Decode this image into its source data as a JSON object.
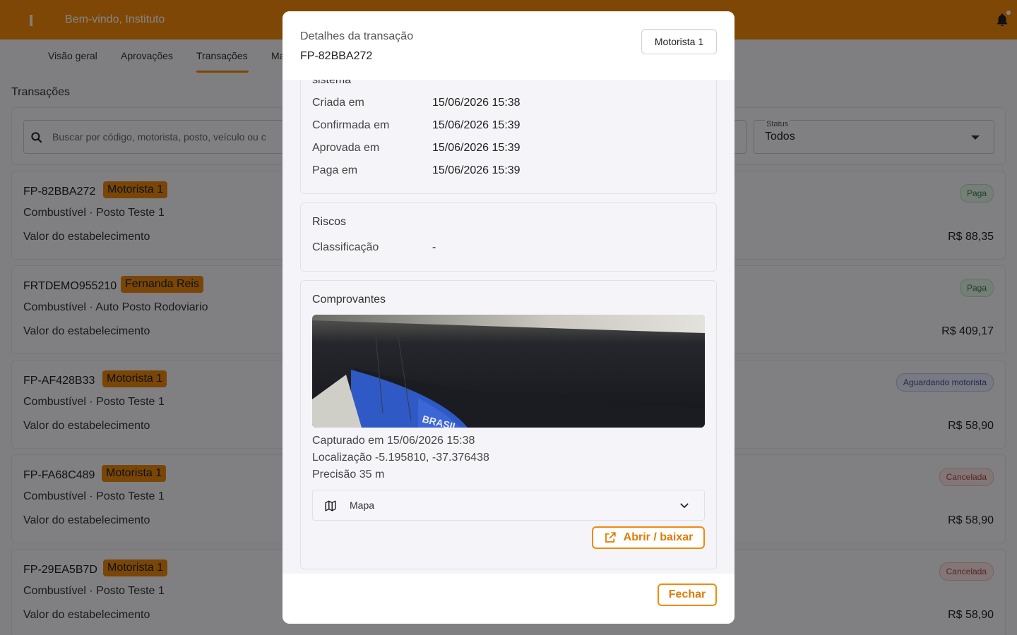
{
  "topbar": {
    "welcome": "Bem-vindo, Instituto"
  },
  "tabs": [
    {
      "label": "Visão geral"
    },
    {
      "label": "Aprovações"
    },
    {
      "label": "Transações"
    },
    {
      "label": "Ma"
    }
  ],
  "page": {
    "title": "Transações"
  },
  "filters": {
    "search_placeholder": "Buscar por código, motorista, posto, veículo ou c",
    "status_label": "Status",
    "status_value": "Todos"
  },
  "transactions": [
    {
      "code": "FP-82BBA272",
      "driver": "Motorista 1",
      "sub": "Combustível · Posto Teste 1",
      "label": "Valor do estabelecimento",
      "amount": "R$ 88,35",
      "status": "Paga"
    },
    {
      "code": "FRTDEMO955210",
      "driver": "Fernanda Reis",
      "sub": "Combustível · Auto Posto Rodoviario",
      "label": "Valor do estabelecimento",
      "amount": "R$ 409,17",
      "status": "Paga"
    },
    {
      "code": "FP-AF428B33",
      "driver": "Motorista 1",
      "sub": "Combustível · Posto Teste 1",
      "label": "Valor do estabelecimento",
      "amount": "R$ 58,90",
      "status": "Aguardando motorista"
    },
    {
      "code": "FP-FA68C489",
      "driver": "Motorista 1",
      "sub": "Combustível · Posto Teste 1",
      "label": "Valor do estabelecimento",
      "amount": "R$ 58,90",
      "status": "Cancelada"
    },
    {
      "code": "FP-29EA5B7D",
      "driver": "Motorista 1",
      "sub": "Combustível · Posto Teste 1",
      "label": "Valor do estabelecimento",
      "amount": "R$ 58,90",
      "status": "Cancelada"
    }
  ],
  "modal": {
    "title": "Detalhes da transação",
    "code": "FP-82BBA272",
    "driver_chip": "Motorista 1",
    "system_section": {
      "title": "sistema",
      "rows": [
        {
          "k": "Criada em",
          "v": "15/06/2026 15:38"
        },
        {
          "k": "Confirmada em",
          "v": "15/06/2026 15:39"
        },
        {
          "k": "Aprovada em",
          "v": "15/06/2026 15:39"
        },
        {
          "k": "Paga em",
          "v": "15/06/2026 15:39"
        }
      ]
    },
    "risks": {
      "title": "Riscos",
      "rows": [
        {
          "k": "Classificação",
          "v": "-"
        }
      ]
    },
    "receipts": {
      "title": "Comprovantes",
      "captured": "Capturado em 15/06/2026 15:38",
      "location": "Localização -5.195810, -37.376438",
      "precision": "Precisão 35 m",
      "map_label": "Mapa",
      "open_label": "Abrir / baixar"
    },
    "close_label": "Fechar"
  },
  "colors": {
    "accent": "#f2890d",
    "overlay": "rgba(0,0,0,0.48)"
  }
}
